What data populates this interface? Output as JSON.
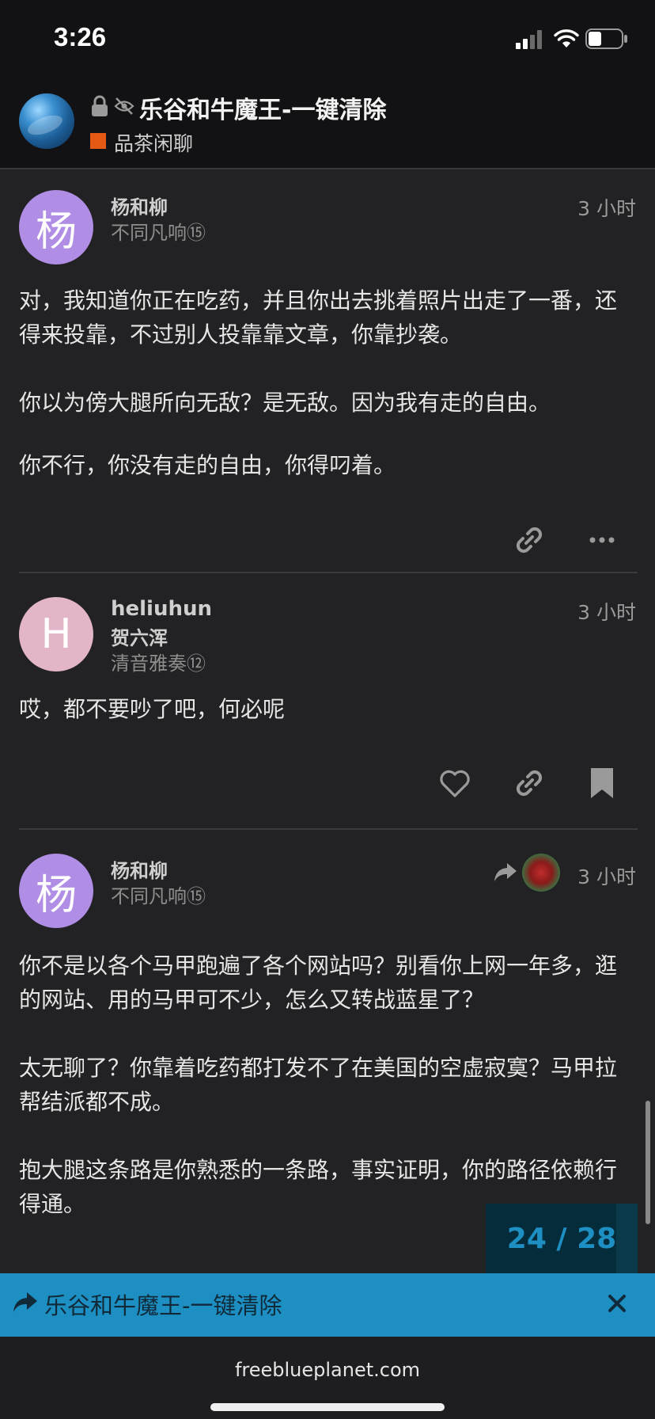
{
  "status_bar": {
    "time": "3:26"
  },
  "topic": {
    "title": "乐谷和牛魔王-一键清除",
    "category": "品茶闲聊",
    "category_color": "#e45a14"
  },
  "posts": [
    {
      "avatar_letter": "杨",
      "username": "杨和柳",
      "subtitle": "不同凡响⑮",
      "time": "3 小时",
      "paragraphs": [
        "对，我知道你正在吃药，并且你出去挑着照片出走了一番，还得来投靠，不过别人投靠靠文章，你靠抄袭。",
        "你以为傍大腿所向无敌？是无敌。因为我有走的自由。",
        "你不行，你没有走的自由，你得叼着。"
      ]
    },
    {
      "avatar_letter": "H",
      "username": "heliuhun",
      "fullname": "贺六浑",
      "subtitle": "清音雅奏⑫",
      "time": "3 小时",
      "paragraphs": [
        "哎，都不要吵了吧，何必呢"
      ]
    },
    {
      "avatar_letter": "杨",
      "username": "杨和柳",
      "subtitle": "不同凡响⑮",
      "time": "3 小时",
      "paragraphs": [
        "你不是以各个马甲跑遍了各个网站吗？别看你上网一年多，逛的网站、用的马甲可不少，怎么又转战蓝星了？",
        "太无聊了？你靠着吃药都打发不了在美国的空虚寂寞？马甲拉帮结派都不成。",
        "抱大腿这条路是你熟悉的一条路，事实证明，你的路径依赖行得通。"
      ]
    }
  ],
  "progress": {
    "text": "24 / 28",
    "current": 24,
    "total": 28
  },
  "share_banner": {
    "title": "乐谷和牛魔王-一键清除"
  },
  "footer": {
    "domain": "freeblueplanet.com"
  },
  "colors": {
    "accent": "#1d8fc2",
    "background": "#222224",
    "header": "#121214"
  }
}
